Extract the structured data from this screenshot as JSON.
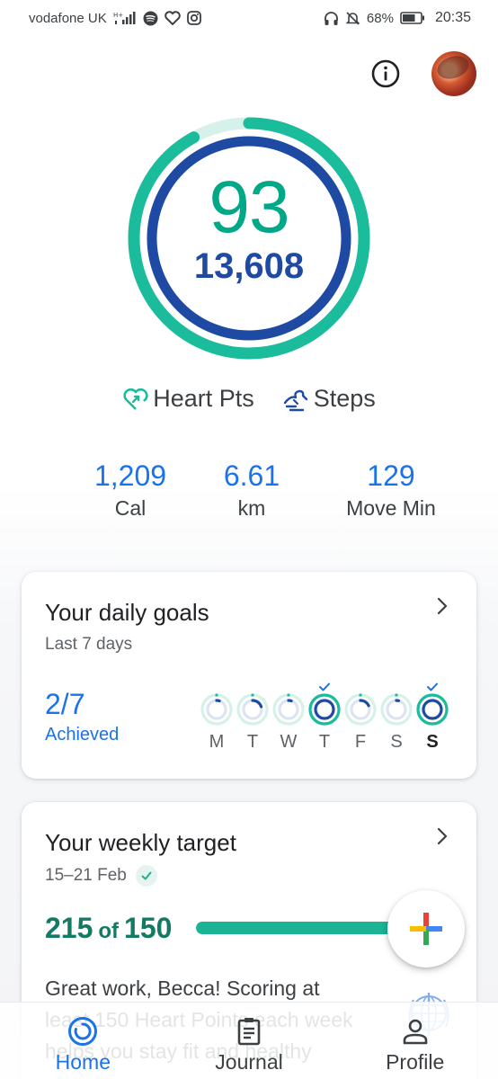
{
  "status_bar": {
    "carrier": "vodafone UK",
    "battery": "68%",
    "time": "20:35"
  },
  "header": {
    "info_icon": "info-icon",
    "avatar": "profile-photo"
  },
  "summary": {
    "heart_points": "93",
    "steps": "13,608",
    "heart_points_goal_fraction": 0.92,
    "steps_goal_fraction": 1.0,
    "legend": {
      "heart_label": "Heart Pts",
      "steps_label": "Steps"
    },
    "colors": {
      "heart": "#1bbc9b",
      "steps": "#1e4aa3"
    }
  },
  "stats": [
    {
      "value": "1,209",
      "label": "Cal"
    },
    {
      "value": "6.61",
      "label": "km"
    },
    {
      "value": "129",
      "label": "Move Min"
    }
  ],
  "daily_goals": {
    "title": "Your daily goals",
    "subtitle": "Last 7 days",
    "achieved_count": "2/7",
    "achieved_label": "Achieved",
    "days": [
      {
        "letter": "M",
        "achieved": false,
        "progress": 0.05
      },
      {
        "letter": "T",
        "achieved": false,
        "progress": 0.2
      },
      {
        "letter": "W",
        "achieved": false,
        "progress": 0.05
      },
      {
        "letter": "T",
        "achieved": true,
        "progress": 1.0
      },
      {
        "letter": "F",
        "achieved": false,
        "progress": 0.18
      },
      {
        "letter": "S",
        "achieved": false,
        "progress": 0.04
      },
      {
        "letter": "S",
        "achieved": true,
        "progress": 1.0,
        "today": true
      }
    ]
  },
  "weekly_target": {
    "title": "Your weekly target",
    "date_range": "15–21 Feb",
    "value": "215",
    "of_label": "of",
    "goal": "150",
    "progress": 1.0,
    "message": "Great work, Becca! Scoring at least 150 Heart Points each week helps you stay fit and healthy"
  },
  "fab": {
    "icon": "add-icon"
  },
  "nav": {
    "items": [
      {
        "label": "Home",
        "icon": "home-icon",
        "active": true
      },
      {
        "label": "Journal",
        "icon": "journal-icon",
        "active": false
      },
      {
        "label": "Profile",
        "icon": "profile-icon",
        "active": false
      }
    ]
  }
}
